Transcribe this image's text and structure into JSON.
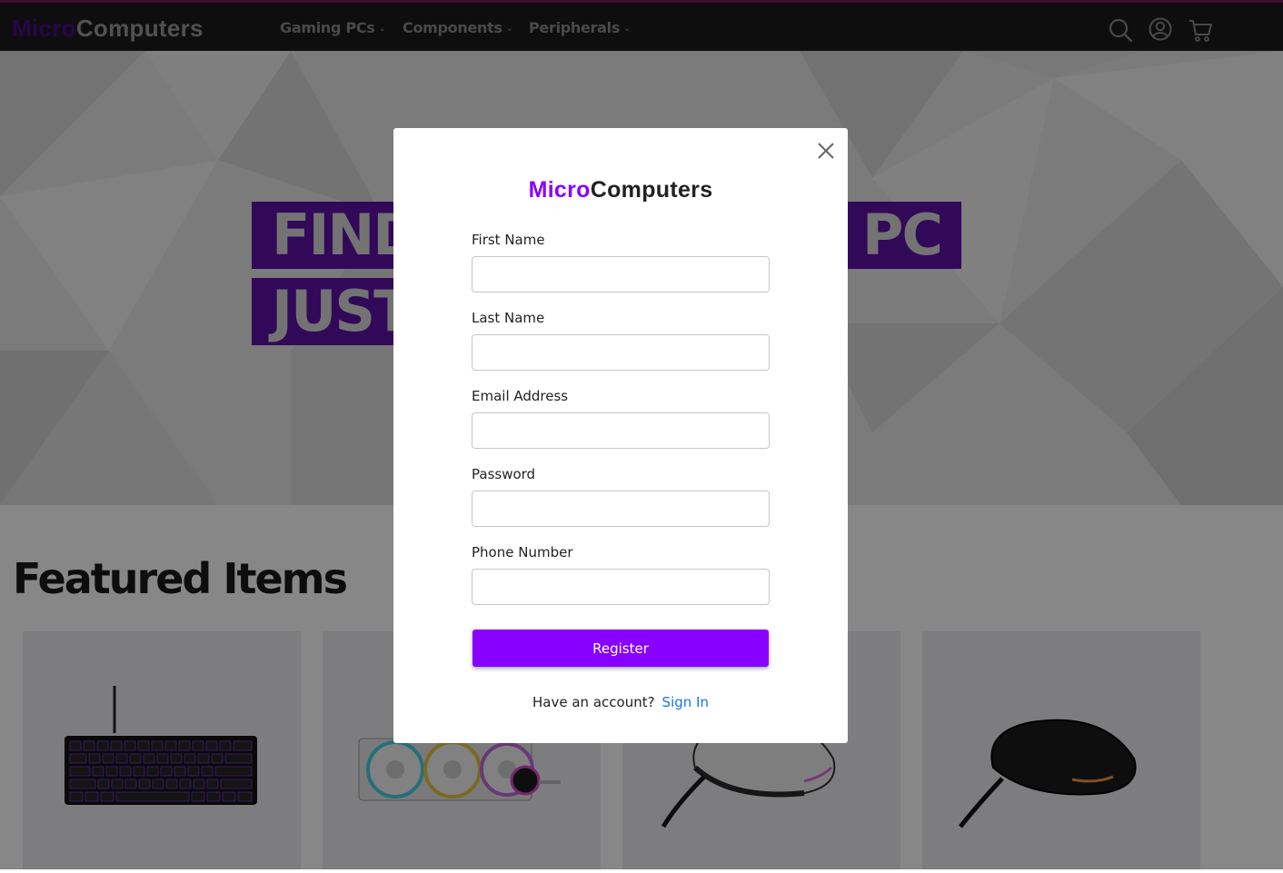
{
  "brand": {
    "part1": "Micro",
    "part2": "Computers"
  },
  "nav": {
    "links": [
      {
        "label": "Gaming PCs"
      },
      {
        "label": "Components"
      },
      {
        "label": "Peripherals"
      }
    ],
    "icons": [
      "search-icon",
      "account-icon",
      "cart-icon"
    ]
  },
  "hero": {
    "line1": "FIND",
    "line1_end": "T PC",
    "line2": "JUST"
  },
  "featured": {
    "title": "Featured Items",
    "cards": [
      "keyboard-image",
      "cooler-image",
      "mouse-white-image",
      "mouse-black-image"
    ]
  },
  "modal": {
    "brand_part1": "Micro",
    "brand_part2": "Computers",
    "fields": [
      {
        "label": "First Name",
        "value": ""
      },
      {
        "label": "Last Name",
        "value": ""
      },
      {
        "label": "Email Address",
        "value": ""
      },
      {
        "label": "Password",
        "value": ""
      },
      {
        "label": "Phone Number",
        "value": ""
      }
    ],
    "register_label": "Register",
    "account_prompt": "Have an account?",
    "signin_label": "Sign In"
  },
  "colors": {
    "navbar": "#1c1c1e",
    "accent": "#8800ff",
    "hero_band": "#5f12a8",
    "link": "#1a73e8"
  }
}
